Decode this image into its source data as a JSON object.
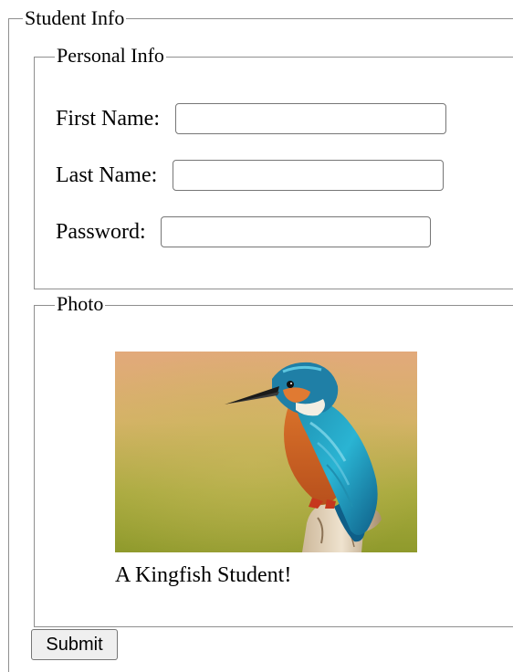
{
  "student_info": {
    "legend": "Student Info"
  },
  "personal_info": {
    "legend": "Personal Info",
    "first_name": {
      "label": "First Name:",
      "value": "",
      "placeholder": ""
    },
    "last_name": {
      "label": "Last Name:",
      "value": "",
      "placeholder": ""
    },
    "password": {
      "label": "Password:",
      "value": "",
      "placeholder": ""
    }
  },
  "photo": {
    "legend": "Photo",
    "image_subject": "kingfisher-bird-photo",
    "caption": "A Kingfish Student!"
  },
  "actions": {
    "submit_label": "Submit"
  },
  "colors": {
    "border": "#8f8f8f",
    "input_border": "#767676",
    "button_bg": "#efefef"
  }
}
